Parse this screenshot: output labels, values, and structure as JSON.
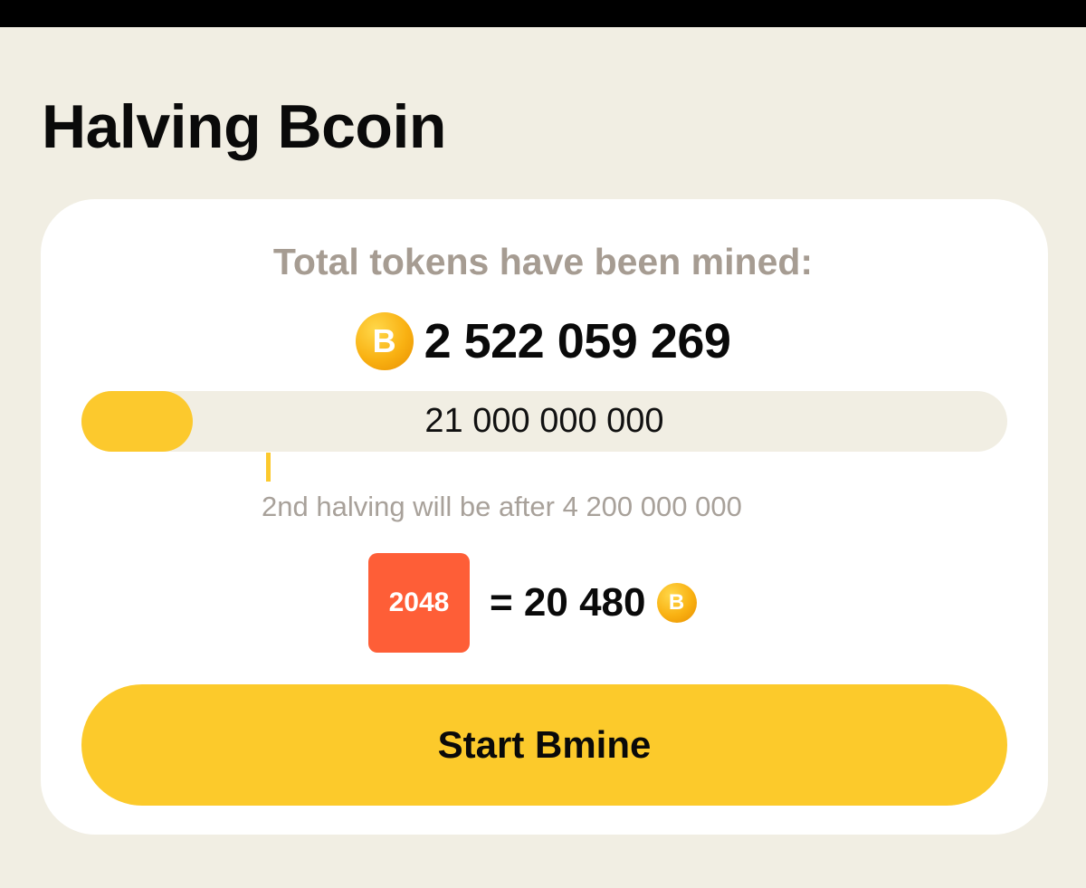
{
  "page": {
    "title": "Halving Bcoin"
  },
  "card": {
    "mined_label": "Total tokens have been mined:",
    "total_mined": "2 522 059 269",
    "coin_symbol": "B",
    "coin_icon": "bcoin-icon",
    "progress": {
      "max_label": "21 000 000 000",
      "mined_fraction": 0.12
    },
    "halving_note": "2nd halving will be after 4 200 000 000",
    "tile": {
      "label": "2048",
      "equals": "= 20 480"
    },
    "start_button_label": "Start Bmine"
  },
  "colors": {
    "background": "#f1eee3",
    "card": "#ffffff",
    "accent_yellow": "#fcc92d",
    "tile_orange": "#fe5e37",
    "muted_text": "#a69c92",
    "coin_gold": "#f9b112"
  }
}
